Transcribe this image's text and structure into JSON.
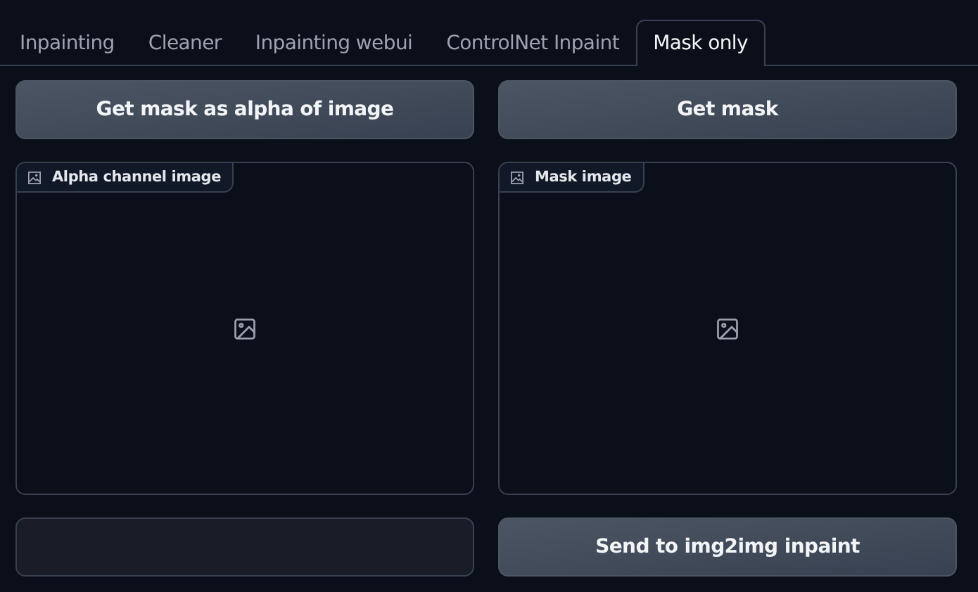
{
  "tabs": [
    {
      "label": "Inpainting",
      "selected": false
    },
    {
      "label": "Cleaner",
      "selected": false
    },
    {
      "label": "Inpainting webui",
      "selected": false
    },
    {
      "label": "ControlNet Inpaint",
      "selected": false
    },
    {
      "label": "Mask only",
      "selected": true
    }
  ],
  "columns": [
    {
      "button": "Get mask as alpha of image",
      "image_label": "Alpha channel image",
      "bottom": {
        "kind": "field"
      }
    },
    {
      "button": "Get mask",
      "image_label": "Mask image",
      "bottom": {
        "kind": "button",
        "label": "Send to img2img inpaint"
      }
    }
  ]
}
